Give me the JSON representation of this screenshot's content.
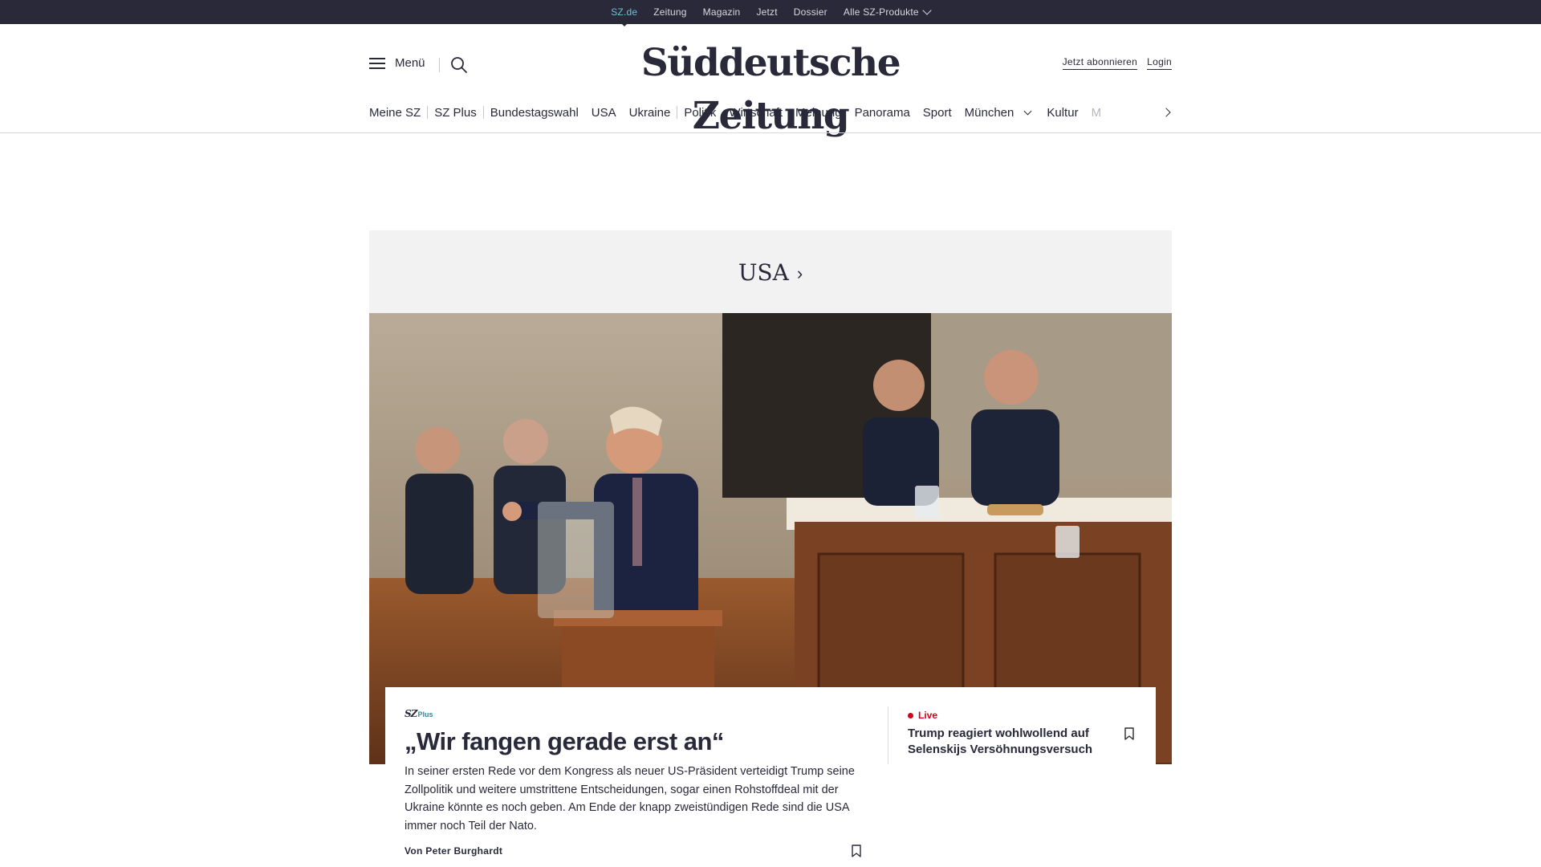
{
  "topbar": {
    "items": [
      "SZ.de",
      "Zeitung",
      "Magazin",
      "Jetzt",
      "Dossier",
      "Alle SZ-Produkte"
    ]
  },
  "header": {
    "menu_label": "Menü",
    "logo": "Süddeutsche Zeitung",
    "subscribe": "Jetzt abonnieren",
    "login": "Login"
  },
  "nav": {
    "items": [
      "Meine SZ",
      "SZ Plus",
      "Bundestagswahl",
      "USA",
      "Ukraine",
      "Politik",
      "Wirtschaft",
      "Meinung",
      "Panorama",
      "Sport",
      "München",
      "Kultur",
      "M"
    ]
  },
  "section": {
    "title": "USA",
    "arrow": "›"
  },
  "lead": {
    "badge_sz": "SZ",
    "badge_plus": "Plus",
    "headline": "„Wir fangen gerade erst an“",
    "teaser": "In seiner ersten Rede vor dem Kongress als neuer US-Präsident verteidigt Trump seine Zollpolitik und weitere umstrittene Entscheidungen, sogar einen Rohstoffdeal mit der Ukraine könnte es noch geben. Am Ende der knapp zweistündigen Rede sind die USA immer noch Teil der Nato.",
    "author": "Von Peter Burghardt"
  },
  "side": {
    "live_label": "Live",
    "title": "Trump reagiert wohlwollend auf Selenskijs Versöhnungsversuch"
  },
  "colors": {
    "dark": "#29293a",
    "accent": "#71c1d3",
    "plus": "#2c8a9e",
    "live": "#d0021b"
  }
}
